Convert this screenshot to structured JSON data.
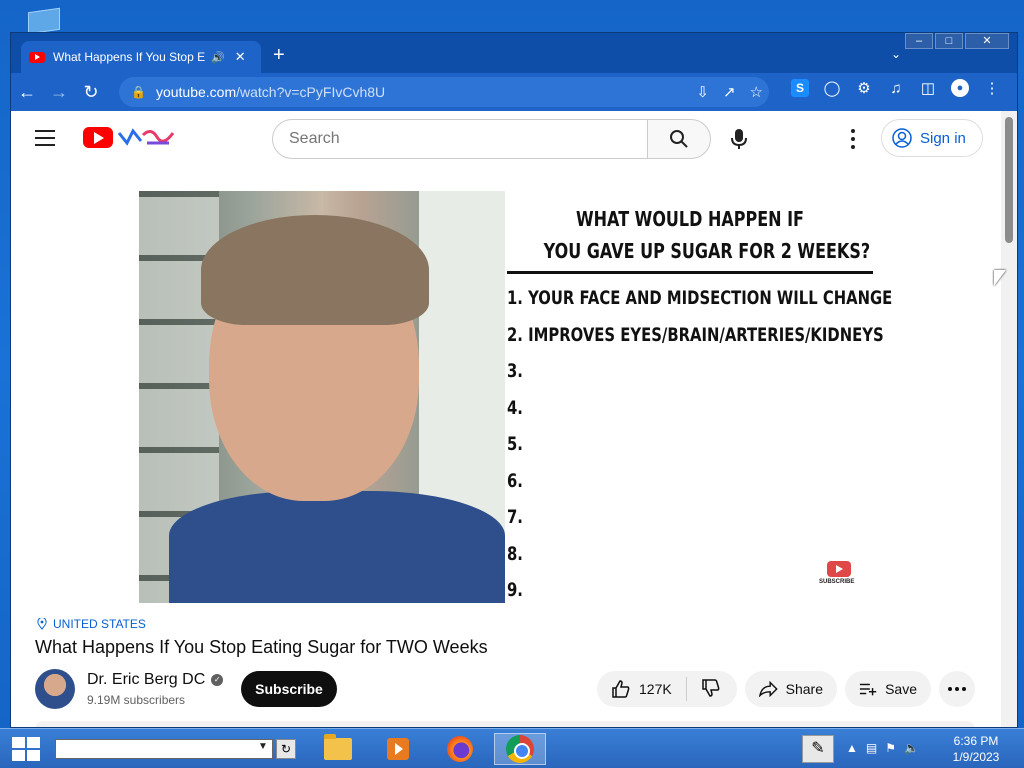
{
  "browser": {
    "tab_title": "What Happens If You Stop E",
    "audio_icon": "speaker-icon",
    "url_host": "youtube.com",
    "url_path": "/watch?v=cPyFIvCvh8U"
  },
  "youtube": {
    "search_placeholder": "Search",
    "sign_in": "Sign in",
    "video_heading_line1": "WHAT WOULD HAPPEN IF",
    "video_heading_line2": "YOU GAVE UP SUGAR FOR 2 WEEKS?",
    "video_list": [
      "1.  YOUR FACE AND MIDSECTION WILL CHANGE",
      "2.  IMPROVES EYES/BRAIN/ARTERIES/KIDNEYS",
      "3.",
      "4.",
      "5.",
      "6.",
      "7.",
      "8.",
      "9."
    ],
    "badge_label": "SUBSCRIBE",
    "location": "UNITED STATES",
    "title": "What Happens If You Stop Eating Sugar for TWO Weeks",
    "channel_name": "Dr. Eric Berg DC",
    "subscribers": "9.19M subscribers",
    "subscribe": "Subscribe",
    "likes": "127K",
    "share": "Share",
    "save": "Save"
  },
  "taskbar": {
    "time": "6:36 PM",
    "date": "1/9/2023"
  },
  "colors": {
    "youtube_red": "#ff0000",
    "link_blue": "#065fd4",
    "chrome_frame": "#1e64c8"
  }
}
